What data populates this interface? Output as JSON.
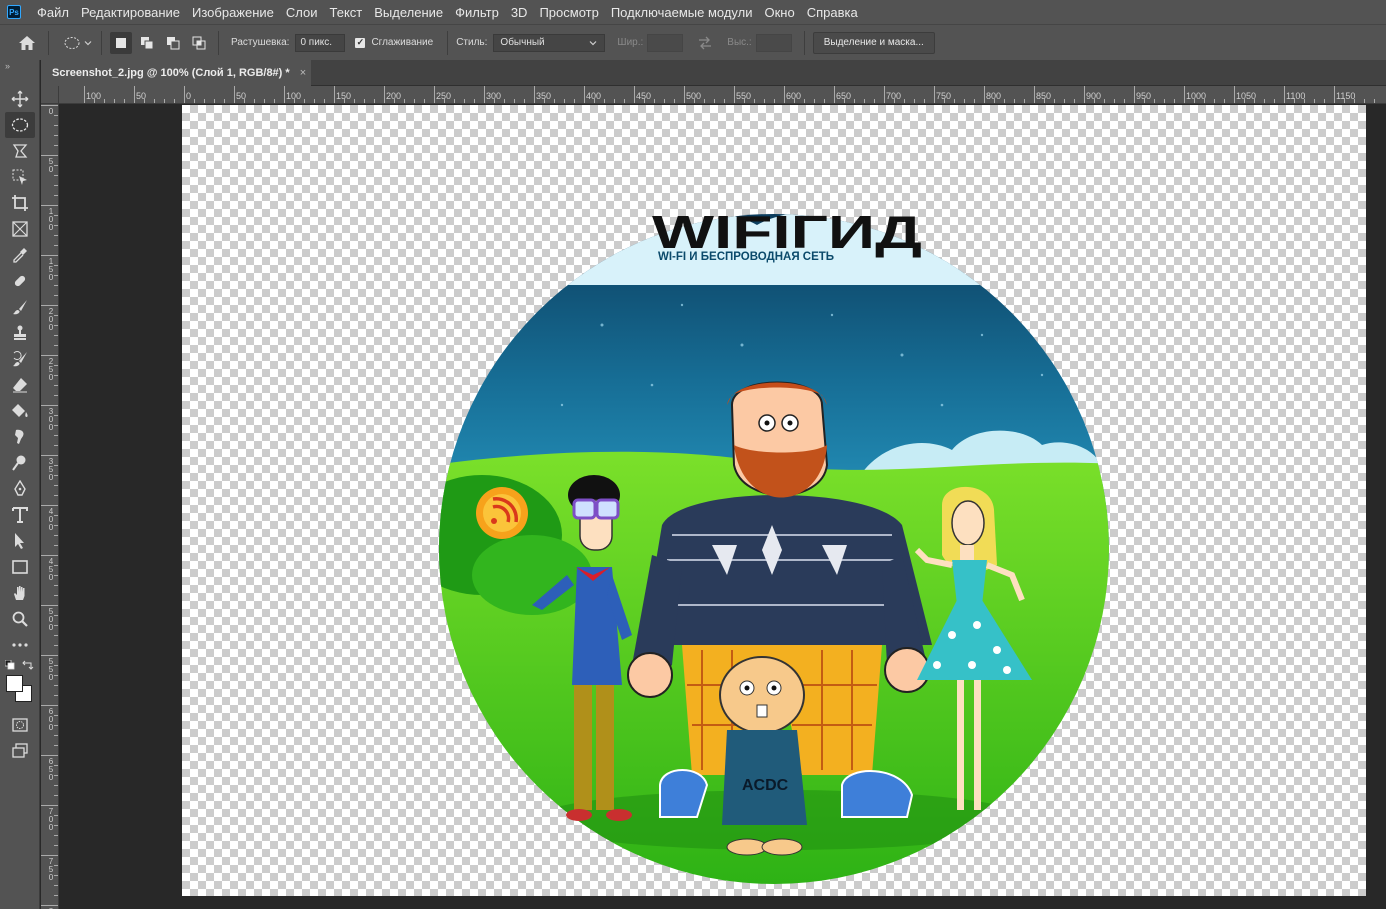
{
  "app": {
    "logo_text": "Ps"
  },
  "menu": [
    "Файл",
    "Редактирование",
    "Изображение",
    "Слои",
    "Текст",
    "Выделение",
    "Фильтр",
    "3D",
    "Просмотр",
    "Подключаемые модули",
    "Окно",
    "Справка"
  ],
  "options": {
    "feather_label": "Растушевка:",
    "feather_value": "0 пикс.",
    "antialias_label": "Сглаживание",
    "style_label": "Стиль:",
    "style_value": "Обычный",
    "width_label": "Шир.:",
    "height_label": "Выс.:",
    "select_mask_button": "Выделение и маска..."
  },
  "document": {
    "tab_title": "Screenshot_2.jpg @ 100% (Слой 1, RGB/8#) *",
    "close_glyph": "×"
  },
  "artwork": {
    "header_text": "WI-FI И БЕСПРОВОДНАЯ СЕТЬ",
    "logo_text": "WIFIГИД",
    "shirt_text": "ACDC"
  },
  "hruler_labels": [
    "100",
    "50",
    "0",
    "50",
    "100",
    "150",
    "200",
    "250",
    "300",
    "350",
    "400",
    "450",
    "500",
    "550",
    "600",
    "650",
    "700",
    "750",
    "800",
    "850",
    "900",
    "950",
    "1000",
    "1050",
    "1100",
    "1150"
  ],
  "vruler_labels": [
    "0",
    "5 0",
    "1 0 0",
    "1 5 0",
    "2 0 0",
    "2 5 0",
    "3 0 0",
    "3 5 0",
    "4 0 0",
    "4 5 0",
    "5 0 0",
    "5 5 0",
    "6 0 0",
    "6 5 0",
    "7 0 0",
    "7 5 0",
    "8 0 0"
  ],
  "tools": [
    "move-icon",
    "elliptical-marquee-icon",
    "lasso-icon",
    "object-select-icon",
    "crop-icon",
    "frame-icon",
    "eyedropper-icon",
    "healing-brush-icon",
    "brush-icon",
    "clone-stamp-icon",
    "history-brush-icon",
    "eraser-icon",
    "paint-bucket-icon",
    "smudge-icon",
    "dodge-icon",
    "pen-icon",
    "type-icon",
    "path-select-icon",
    "rectangle-icon",
    "hand-icon",
    "zoom-icon",
    "more-tools-icon"
  ],
  "colors": {
    "foreground": "#ffffff",
    "background": "#ffffff",
    "accent": "#31a8ff"
  }
}
